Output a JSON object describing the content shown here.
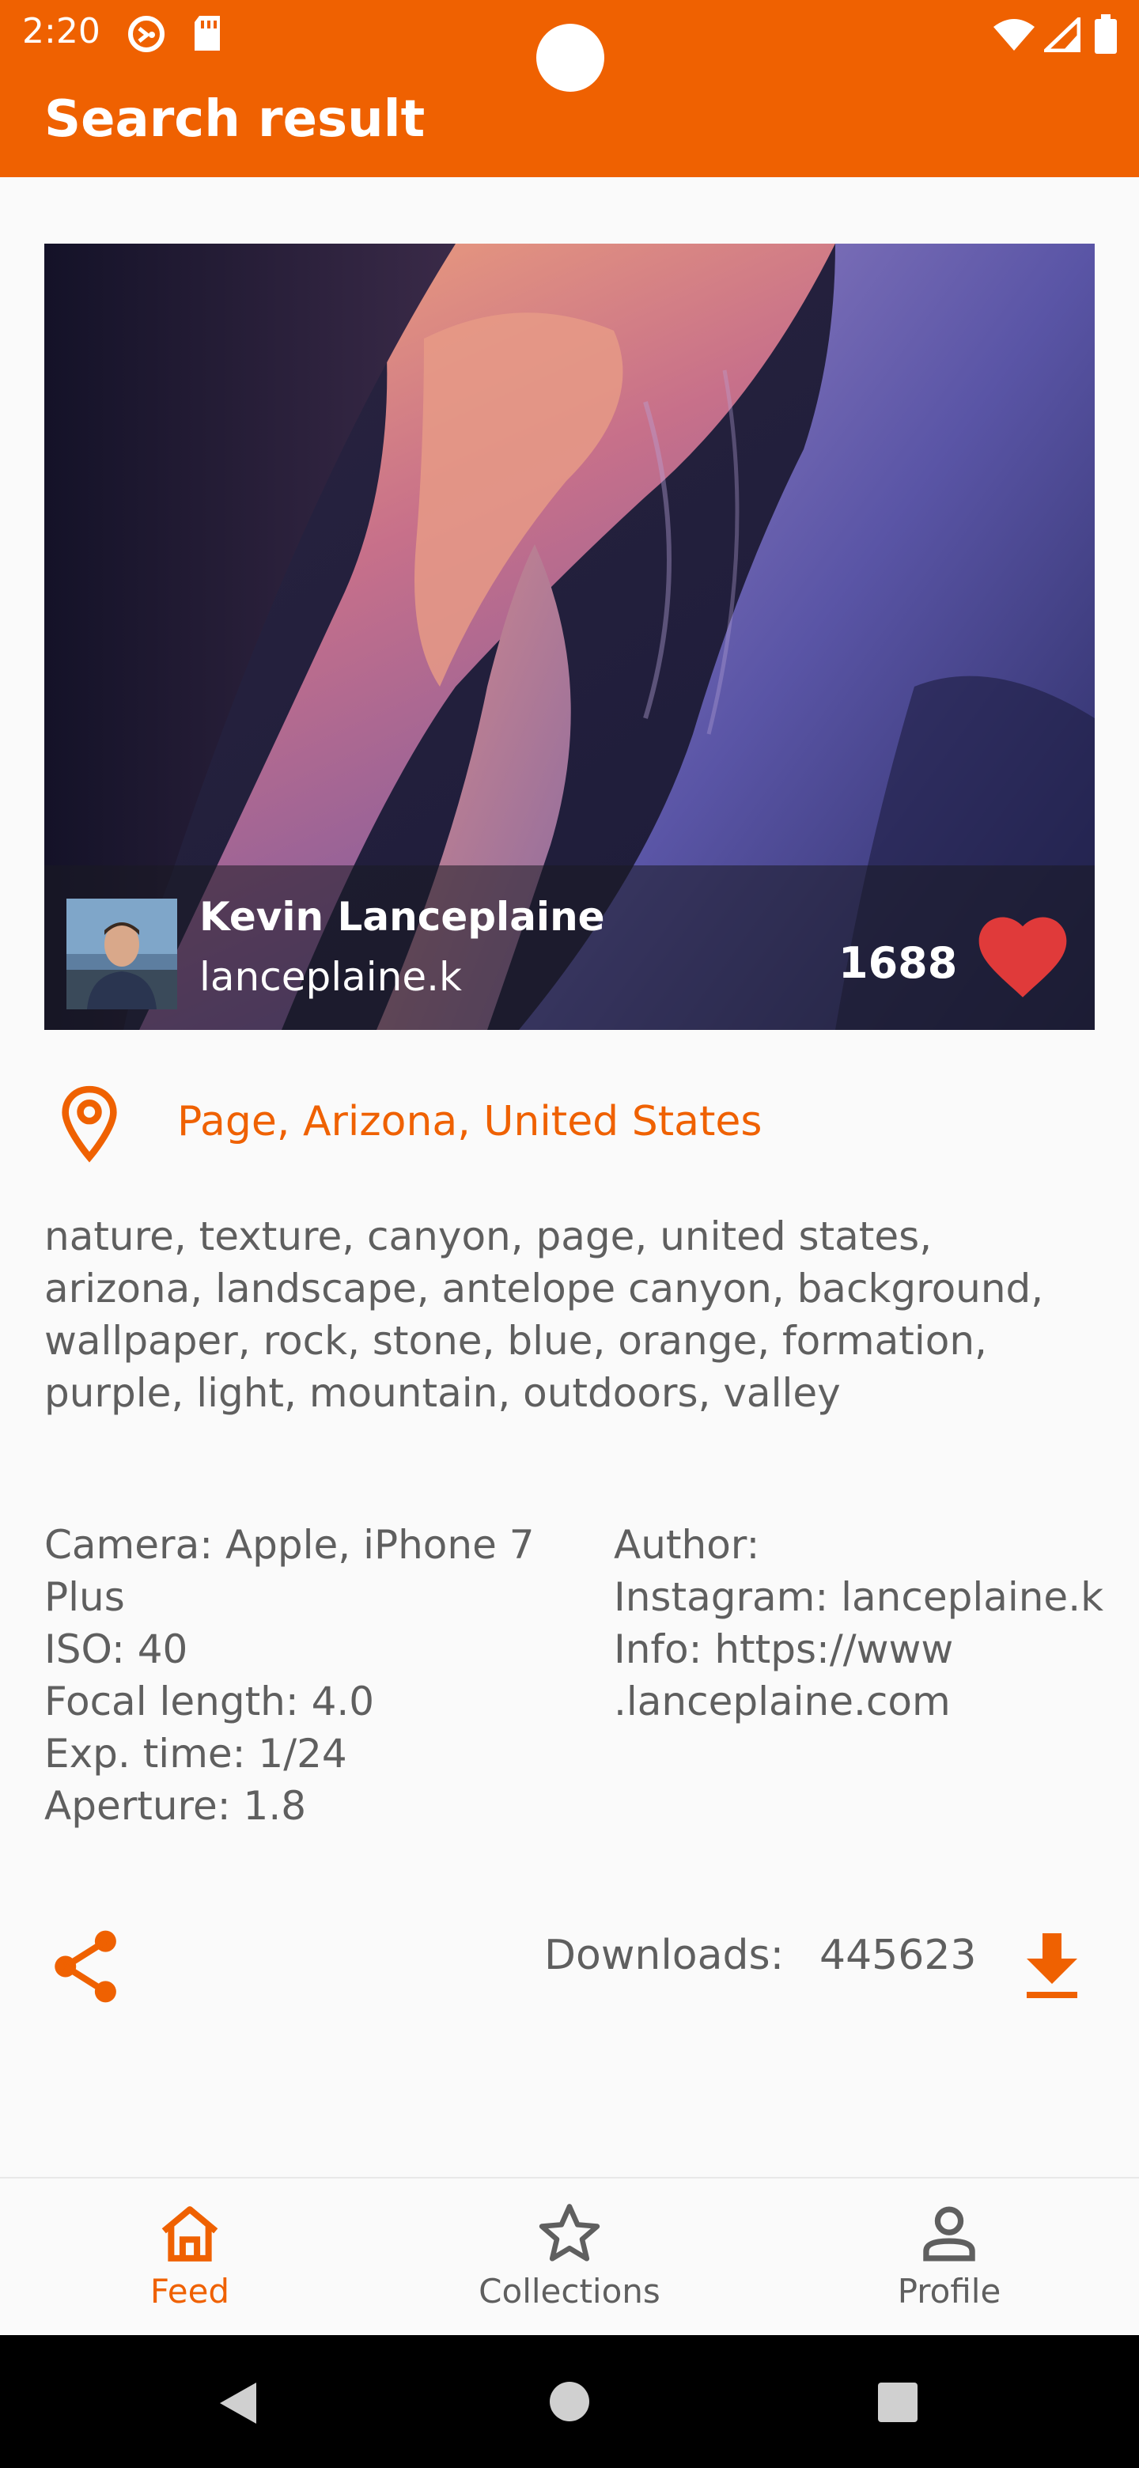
{
  "status_bar": {
    "time": "2:20",
    "icons": [
      "sync-icon",
      "sd-card-icon",
      "wifi-icon",
      "signal-icon",
      "battery-icon"
    ]
  },
  "app_bar": {
    "title": "Search result"
  },
  "photo": {
    "author_name": "Kevin Lanceplaine",
    "author_username": "lanceplaine.k",
    "likes": "1688"
  },
  "location": {
    "text": "Page, Arizona, United States"
  },
  "tags": [
    " nature",
    "texture",
    "canyon",
    "page",
    "united states",
    "arizona",
    "landscape",
    "antelope canyon",
    "background",
    "wallpaper",
    "rock",
    "stone",
    "blue",
    "orange",
    "formation",
    "purple",
    "light",
    "mountain",
    "outdoors",
    "valley"
  ],
  "exif": {
    "camera_line1": "Camera: Apple, iPhone 7",
    "camera_line2": "Plus",
    "iso": "ISO: 40",
    "focal_length": "Focal length: 4.0",
    "exposure": "Exp. time: 1/24",
    "aperture": "Aperture: 1.8"
  },
  "author_info": {
    "author_label": "Author:",
    "instagram": "Instagram: lanceplaine.k",
    "info_line1": "Info: https://www",
    "info_line2": ".lanceplaine.com"
  },
  "downloads": {
    "label": "Downloads:",
    "count": "445623"
  },
  "bottom_nav": [
    {
      "label": "Feed",
      "icon": "home-icon",
      "active": true
    },
    {
      "label": "Collections",
      "icon": "star-icon",
      "active": false
    },
    {
      "label": "Profile",
      "icon": "person-icon",
      "active": false
    }
  ],
  "colors": {
    "accent": "#ef6101",
    "heart": "#e03a3a",
    "text": "#5f5f5f"
  }
}
